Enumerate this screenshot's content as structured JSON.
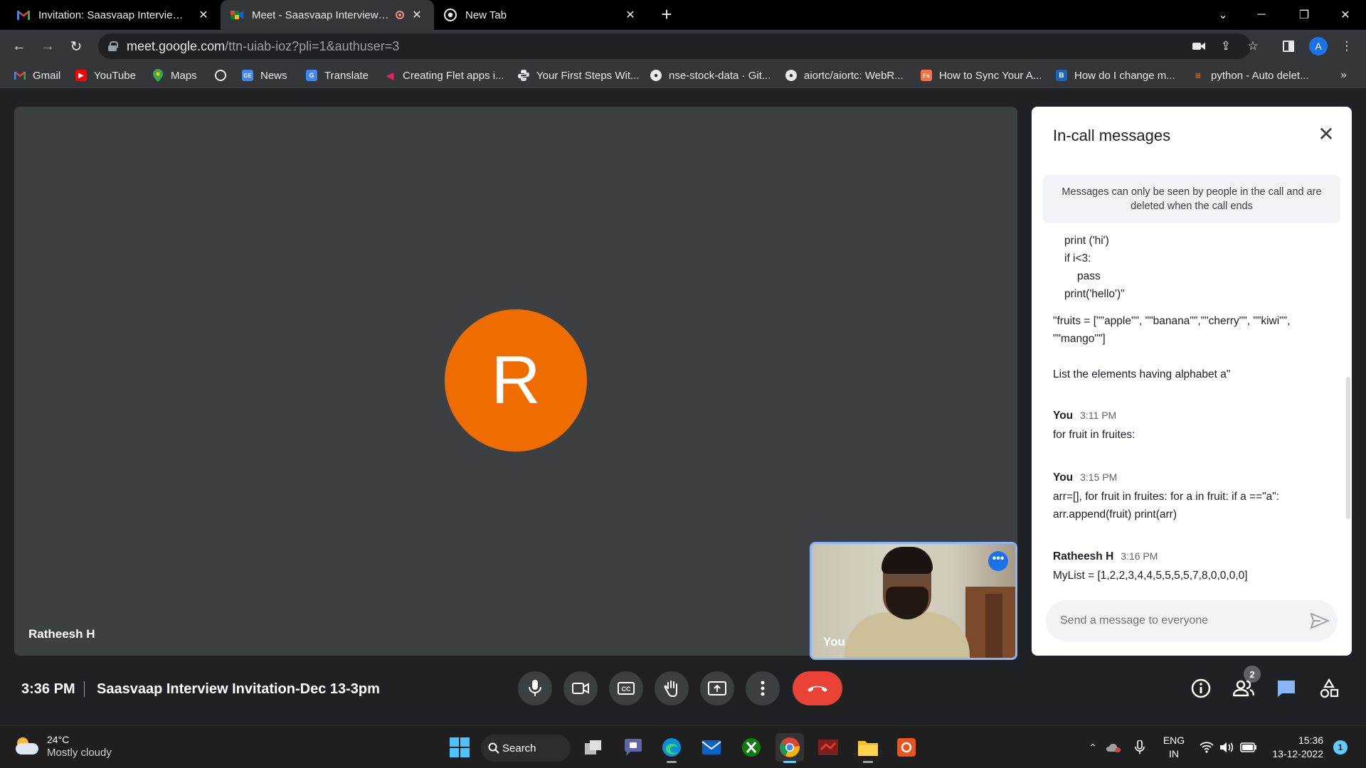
{
  "browser": {
    "tabs": [
      {
        "title": "Invitation: Saasvaap Interview Invitation",
        "icon": "gmail-icon"
      },
      {
        "title": "Meet - Saasvaap Interview Invitation",
        "icon": "meet-icon",
        "recording": true
      },
      {
        "title": "New Tab",
        "icon": "chrome-icon"
      }
    ],
    "url_host": "meet.google.com",
    "url_path": "/ttn-uiab-ioz?pli=1&authuser=3",
    "profile_initial": "A",
    "bookmarks": [
      {
        "label": "Gmail",
        "icon": "gmail-icon"
      },
      {
        "label": "YouTube",
        "icon": "youtube-icon"
      },
      {
        "label": "Maps",
        "icon": "maps-icon"
      },
      {
        "label": "",
        "icon": "globe-icon"
      },
      {
        "label": "News",
        "icon": "news-icon"
      },
      {
        "label": "Translate",
        "icon": "translate-icon"
      },
      {
        "label": "Creating Flet apps i...",
        "icon": "flet-icon"
      },
      {
        "label": "Your First Steps Wit...",
        "icon": "python-icon"
      },
      {
        "label": "nse-stock-data · Git...",
        "icon": "github-icon"
      },
      {
        "label": "aiortc/aiortc: WebR...",
        "icon": "github-icon"
      },
      {
        "label": "How to Sync Your A...",
        "icon": "fs-icon"
      },
      {
        "label": "How do I change m...",
        "icon": "b-icon"
      },
      {
        "label": "python - Auto delet...",
        "icon": "stackoverflow-icon"
      }
    ],
    "bookmarks_overflow": "»"
  },
  "meet": {
    "avatar_letter": "R",
    "avatar_color": "#ef6c00",
    "participant_name": "Ratheesh H",
    "self_label": "You",
    "time": "3:36 PM",
    "separator": "|",
    "meeting_title": "Saasvaap Interview Invitation-Dec 13-3pm",
    "participants_count": "2",
    "end_call_color": "#ea4335"
  },
  "chat": {
    "title": "In-call messages",
    "notice": "Messages can only be seen by people in the call and are deleted when the call ends",
    "code_lines": [
      "print ('hi')",
      "if i<3:",
      "pass",
      "print('hello')\""
    ],
    "fruits_line1": "\"fruits = [\"\"apple\"\", \"\"banana\"\",\"\"cherry\"\", \"\"kiwi\"\",",
    "fruits_line2": "\"\"mango\"\"]",
    "question": "List the elements having alphabet a\"",
    "messages": [
      {
        "sender": "You",
        "time": "3:11 PM",
        "lines": [
          "for fruit in fruites:"
        ]
      },
      {
        "sender": "You",
        "time": "3:15 PM",
        "lines": [
          "arr=[], for fruit in fruites: for a in fruit: if a ==\"a\":",
          "arr.append(fruit) print(arr)"
        ]
      },
      {
        "sender": "Ratheesh H",
        "time": "3:16 PM",
        "lines": [
          "MyList = [1,2,2,3,4,4,5,5,5,5,7,8,0,0,0,0]"
        ]
      }
    ],
    "input_placeholder": "Send a message to everyone"
  },
  "taskbar": {
    "temperature": "24°C",
    "weather": "Mostly cloudy",
    "search_label": "Search",
    "language_1": "ENG",
    "language_2": "IN",
    "clock_time": "15:36",
    "clock_date": "13-12-2022",
    "notifications": "1"
  }
}
